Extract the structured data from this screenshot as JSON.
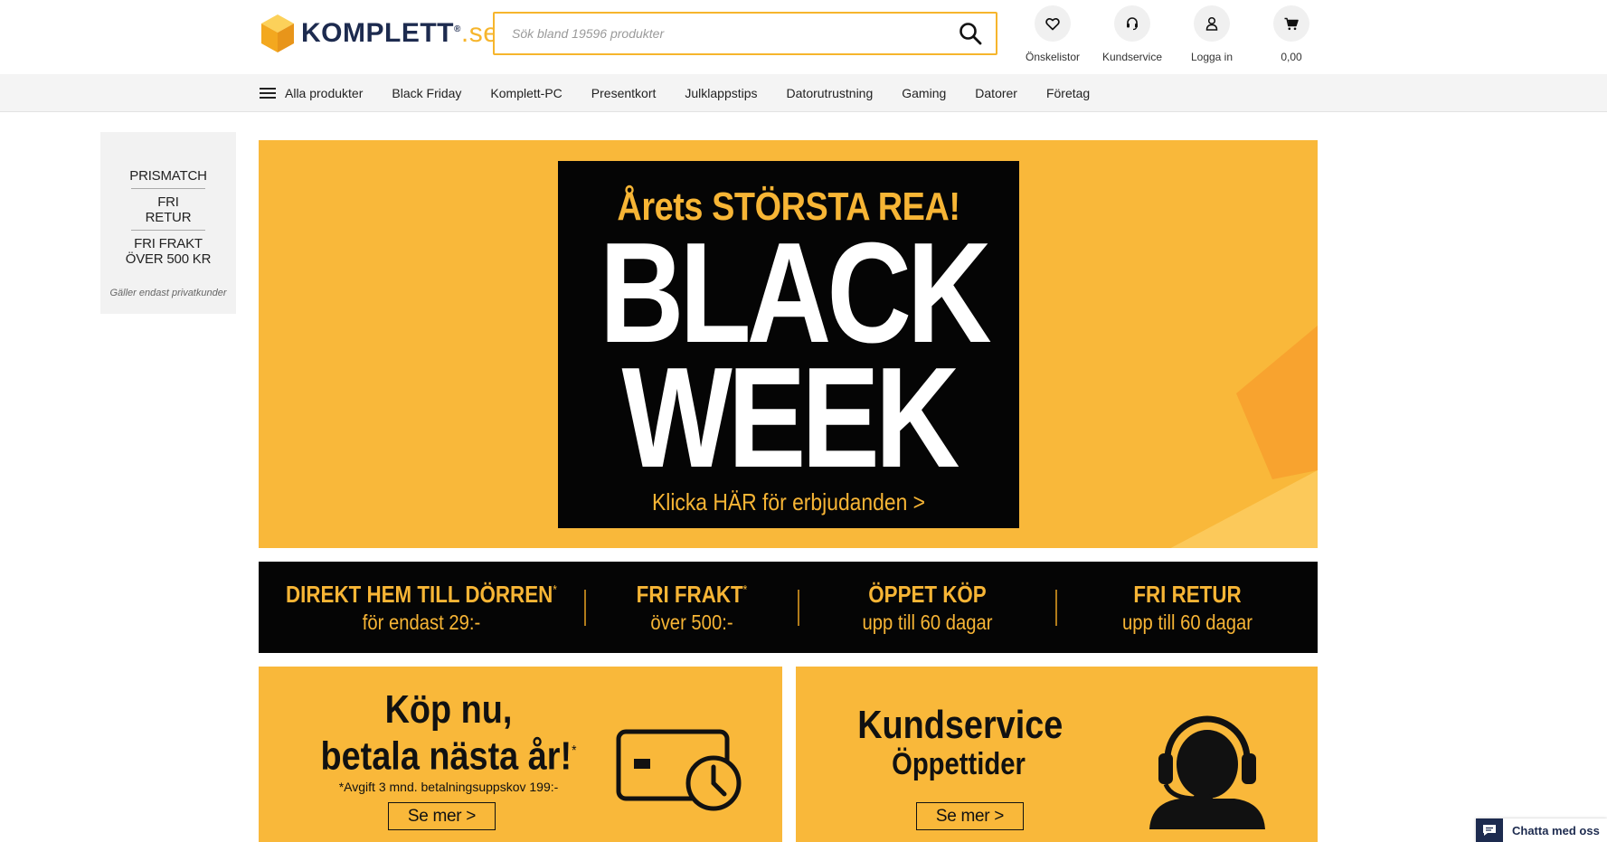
{
  "logo": {
    "text": "KOMPLETT",
    "suffix": ".se",
    "reg": "®"
  },
  "search": {
    "placeholder": "Sök bland 19596 produkter"
  },
  "header_icons": [
    {
      "label": "Önskelistor",
      "icon": "heart-icon"
    },
    {
      "label": "Kundservice",
      "icon": "headset-icon"
    },
    {
      "label": "Logga in",
      "icon": "user-icon"
    },
    {
      "label": "0,00",
      "icon": "cart-icon"
    }
  ],
  "nav": {
    "items": [
      "Alla produkter",
      "Black Friday",
      "Komplett-PC",
      "Presentkort",
      "Julklappstips",
      "Datorutrustning",
      "Gaming",
      "Datorer",
      "Företag"
    ]
  },
  "side_promo": {
    "line1": "PRISMATCH",
    "line2a": "FRI",
    "line2b": "RETUR",
    "line3a": "FRI FRAKT",
    "line3b": "ÖVER 500 KR",
    "note": "Gäller endast privatkunder"
  },
  "hero": {
    "subtitle": "Årets STÖRSTA REA!",
    "line1": "BLACK",
    "line2": "WEEK",
    "cta": "Klicka HÄR för erbjudanden >"
  },
  "usp": [
    {
      "title": "DIREKT HEM TILL DÖRREN",
      "star": "*",
      "sub": "för endast 29:-"
    },
    {
      "title": "FRI FRAKT",
      "star": "*",
      "sub": "över 500:-"
    },
    {
      "title": "ÖPPET KÖP",
      "star": "",
      "sub": "upp till 60 dagar"
    },
    {
      "title": "FRI RETUR",
      "star": "",
      "sub": "upp till 60 dagar"
    }
  ],
  "card_pay": {
    "title1": "Köp nu,",
    "title2": "betala nästa år!",
    "star": "*",
    "note": "*Avgift 3 mnd. betalningsuppskov 199:-",
    "button": "Se mer >"
  },
  "card_service": {
    "title1": "Kundservice",
    "title2": "Öppettider",
    "button": "Se mer >"
  },
  "chat": {
    "label": "Chatta med oss"
  },
  "colors": {
    "accent": "#f9b83a",
    "brand_navy": "#1d2b4f",
    "black": "#050505"
  }
}
